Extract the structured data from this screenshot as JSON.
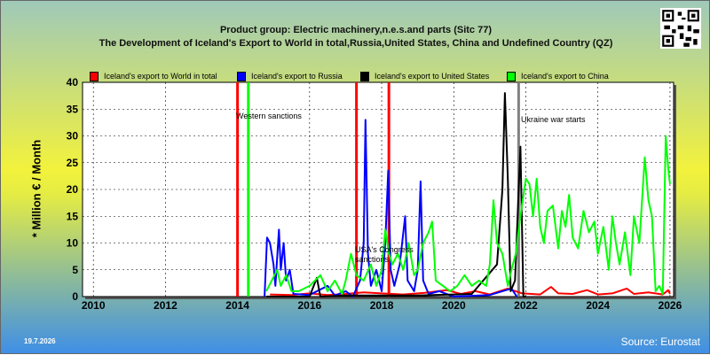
{
  "header": {
    "title_line1": "Product group: Electric machinery,n.e.s.and parts (Sitc 77)",
    "title_line2": "The Development of Iceland's Export to World in total,Russia,United States, China and Undefined Country (QZ)"
  },
  "footer": {
    "date": "19.7.2026",
    "source": "Source: Eurostat"
  },
  "colors": {
    "world": "#ff0000",
    "russia": "#0000ff",
    "us": "#000000",
    "china": "#00ff00",
    "marker": "#808080"
  },
  "chart_data": {
    "type": "line",
    "ylabel": "* Million € / Month",
    "xlabel": "",
    "ylim": [
      0,
      40
    ],
    "xlim": [
      2009.7,
      2026.1
    ],
    "yticks": [
      0,
      5,
      10,
      15,
      20,
      25,
      30,
      35,
      40
    ],
    "xticks": [
      2010,
      2012,
      2014,
      2016,
      2018,
      2020,
      2022,
      2024,
      2026
    ],
    "grid": true,
    "legend_position": "top",
    "series": [
      {
        "name": "Iceland's export to World in total",
        "color": "#ff0000",
        "points": [
          [
            2014.9,
            0.4
          ],
          [
            2015.5,
            0.3
          ],
          [
            2016.0,
            0.6
          ],
          [
            2016.5,
            0.3
          ],
          [
            2017.0,
            0.5
          ],
          [
            2017.5,
            0.8
          ],
          [
            2018.0,
            0.6
          ],
          [
            2018.6,
            0.4
          ],
          [
            2019.2,
            0.7
          ],
          [
            2019.8,
            1.2
          ],
          [
            2020.2,
            0.5
          ],
          [
            2020.6,
            1.0
          ],
          [
            2021.0,
            0.4
          ],
          [
            2021.5,
            1.5
          ],
          [
            2021.9,
            0.6
          ],
          [
            2022.4,
            0.4
          ],
          [
            2022.7,
            1.8
          ],
          [
            2022.9,
            0.6
          ],
          [
            2023.3,
            0.5
          ],
          [
            2023.7,
            1.2
          ],
          [
            2024.0,
            0.4
          ],
          [
            2024.4,
            0.6
          ],
          [
            2024.8,
            1.5
          ],
          [
            2025.0,
            0.5
          ],
          [
            2025.4,
            0.8
          ],
          [
            2025.8,
            0.4
          ],
          [
            2025.95,
            1.2
          ],
          [
            2026.0,
            0.5
          ]
        ]
      },
      {
        "name": "Iceland's export to Russia",
        "color": "#0000ff",
        "points": [
          [
            2014.75,
            0
          ],
          [
            2014.82,
            11
          ],
          [
            2014.9,
            10
          ],
          [
            2015.0,
            6
          ],
          [
            2015.05,
            2
          ],
          [
            2015.15,
            12.5
          ],
          [
            2015.2,
            5
          ],
          [
            2015.28,
            10
          ],
          [
            2015.35,
            3
          ],
          [
            2015.45,
            5
          ],
          [
            2015.55,
            0.5
          ],
          [
            2016.0,
            0.3
          ],
          [
            2016.5,
            2
          ],
          [
            2016.7,
            0.2
          ],
          [
            2017.0,
            1
          ],
          [
            2017.2,
            0
          ],
          [
            2017.4,
            3
          ],
          [
            2017.5,
            10
          ],
          [
            2017.55,
            33
          ],
          [
            2017.62,
            8
          ],
          [
            2017.7,
            2
          ],
          [
            2017.85,
            5
          ],
          [
            2018.0,
            1
          ],
          [
            2018.1,
            10
          ],
          [
            2018.18,
            23.5
          ],
          [
            2018.25,
            5
          ],
          [
            2018.35,
            2
          ],
          [
            2018.5,
            6
          ],
          [
            2018.65,
            15
          ],
          [
            2018.72,
            3
          ],
          [
            2018.9,
            1
          ],
          [
            2019.0,
            5
          ],
          [
            2019.08,
            21.5
          ],
          [
            2019.15,
            3
          ],
          [
            2019.3,
            0.5
          ],
          [
            2019.6,
            1
          ],
          [
            2020.0,
            0
          ],
          [
            2021.0,
            0.3
          ],
          [
            2021.6,
            1.5
          ],
          [
            2021.75,
            0
          ]
        ]
      },
      {
        "name": "Iceland's export to United States",
        "color": "#000000",
        "points": [
          [
            2014.8,
            0
          ],
          [
            2016.0,
            0
          ],
          [
            2016.2,
            3.5
          ],
          [
            2016.3,
            0
          ],
          [
            2017.0,
            0.2
          ],
          [
            2019.0,
            0.2
          ],
          [
            2020.5,
            0.5
          ],
          [
            2021.2,
            6
          ],
          [
            2021.35,
            20
          ],
          [
            2021.42,
            38
          ],
          [
            2021.5,
            22
          ],
          [
            2021.58,
            1
          ],
          [
            2021.7,
            3
          ],
          [
            2021.85,
            28
          ],
          [
            2021.93,
            0
          ],
          [
            2022.0,
            0
          ]
        ]
      },
      {
        "name": "Iceland's export to China",
        "color": "#00ff00",
        "points": [
          [
            2014.8,
            1
          ],
          [
            2014.95,
            3
          ],
          [
            2015.1,
            5
          ],
          [
            2015.2,
            2
          ],
          [
            2015.35,
            4
          ],
          [
            2015.5,
            1
          ],
          [
            2015.7,
            1
          ],
          [
            2016.0,
            2
          ],
          [
            2016.3,
            4
          ],
          [
            2016.5,
            1
          ],
          [
            2016.7,
            3
          ],
          [
            2016.9,
            0.5
          ],
          [
            2017.0,
            3
          ],
          [
            2017.15,
            8
          ],
          [
            2017.3,
            4
          ],
          [
            2017.5,
            3
          ],
          [
            2017.7,
            6
          ],
          [
            2017.85,
            2
          ],
          [
            2018.0,
            5
          ],
          [
            2018.1,
            12.5
          ],
          [
            2018.2,
            8
          ],
          [
            2018.3,
            6
          ],
          [
            2018.45,
            8
          ],
          [
            2018.6,
            5
          ],
          [
            2018.75,
            10
          ],
          [
            2018.9,
            4
          ],
          [
            2019.0,
            5
          ],
          [
            2019.15,
            10
          ],
          [
            2019.3,
            12
          ],
          [
            2019.4,
            14
          ],
          [
            2019.5,
            3
          ],
          [
            2019.7,
            2
          ],
          [
            2019.9,
            1
          ],
          [
            2020.1,
            2
          ],
          [
            2020.3,
            4
          ],
          [
            2020.5,
            2
          ],
          [
            2020.7,
            3
          ],
          [
            2020.9,
            2
          ],
          [
            2021.0,
            6
          ],
          [
            2021.1,
            18
          ],
          [
            2021.2,
            10
          ],
          [
            2021.35,
            8
          ],
          [
            2021.5,
            2
          ],
          [
            2021.6,
            5
          ],
          [
            2021.72,
            8
          ],
          [
            2021.85,
            15
          ],
          [
            2022.0,
            22
          ],
          [
            2022.1,
            21
          ],
          [
            2022.2,
            15
          ],
          [
            2022.3,
            22
          ],
          [
            2022.4,
            13
          ],
          [
            2022.5,
            10
          ],
          [
            2022.6,
            16
          ],
          [
            2022.75,
            17
          ],
          [
            2022.9,
            9
          ],
          [
            2023.0,
            16
          ],
          [
            2023.1,
            13
          ],
          [
            2023.2,
            19
          ],
          [
            2023.3,
            11
          ],
          [
            2023.45,
            9
          ],
          [
            2023.6,
            16
          ],
          [
            2023.75,
            12
          ],
          [
            2023.9,
            14
          ],
          [
            2024.0,
            8
          ],
          [
            2024.15,
            13
          ],
          [
            2024.3,
            5
          ],
          [
            2024.4,
            15
          ],
          [
            2024.5,
            10
          ],
          [
            2024.6,
            6
          ],
          [
            2024.75,
            12
          ],
          [
            2024.9,
            4
          ],
          [
            2025.0,
            15
          ],
          [
            2025.15,
            10
          ],
          [
            2025.3,
            26
          ],
          [
            2025.4,
            18
          ],
          [
            2025.5,
            15
          ],
          [
            2025.6,
            1
          ],
          [
            2025.7,
            2
          ],
          [
            2025.8,
            0.5
          ],
          [
            2025.88,
            30
          ],
          [
            2025.95,
            24
          ],
          [
            2026.0,
            21
          ]
        ]
      }
    ],
    "annotations": [
      {
        "x": 2014.0,
        "text": "Western sanctions",
        "line_color": "#ff0000"
      },
      {
        "x": 2014.3,
        "text": "",
        "line_color": "#00ff00"
      },
      {
        "x": 2017.3,
        "text": "USA's Congress sanctions",
        "line_color": "#ff0000"
      },
      {
        "x": 2018.2,
        "text": "",
        "line_color": "#ff0000"
      },
      {
        "x": 2021.8,
        "text": "Ukraine war starts",
        "line_color": "#808080"
      }
    ]
  }
}
